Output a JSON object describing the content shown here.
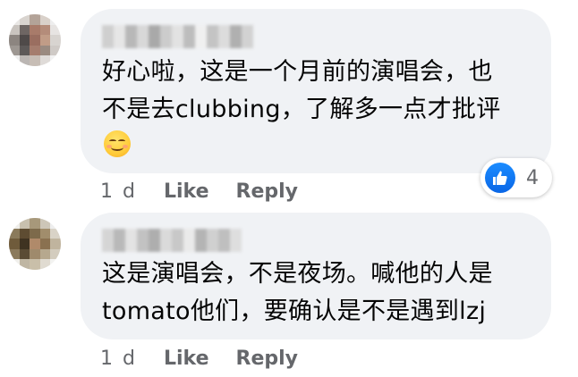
{
  "comments": [
    {
      "author_name": "",
      "text": "好心啦，这是一个月前的演唱会，也\n不是去clubbing，了解多一点才批评",
      "emoji": "blush-smile-emoji",
      "time": "1 d",
      "like_label": "Like",
      "reply_label": "Reply",
      "reaction": {
        "icon": "thumbs-up-icon",
        "count": "4"
      }
    },
    {
      "author_name": "",
      "text": "这是演唱会，不是夜场。喊他的人是\ntomato他们，要确认是不是遇到lzj",
      "time": "1 d",
      "like_label": "Like",
      "reply_label": "Reply"
    }
  ],
  "colors": {
    "bubble": "#f0f2f5",
    "secondary_text": "#65676b",
    "like_blue": "#1877f2"
  }
}
